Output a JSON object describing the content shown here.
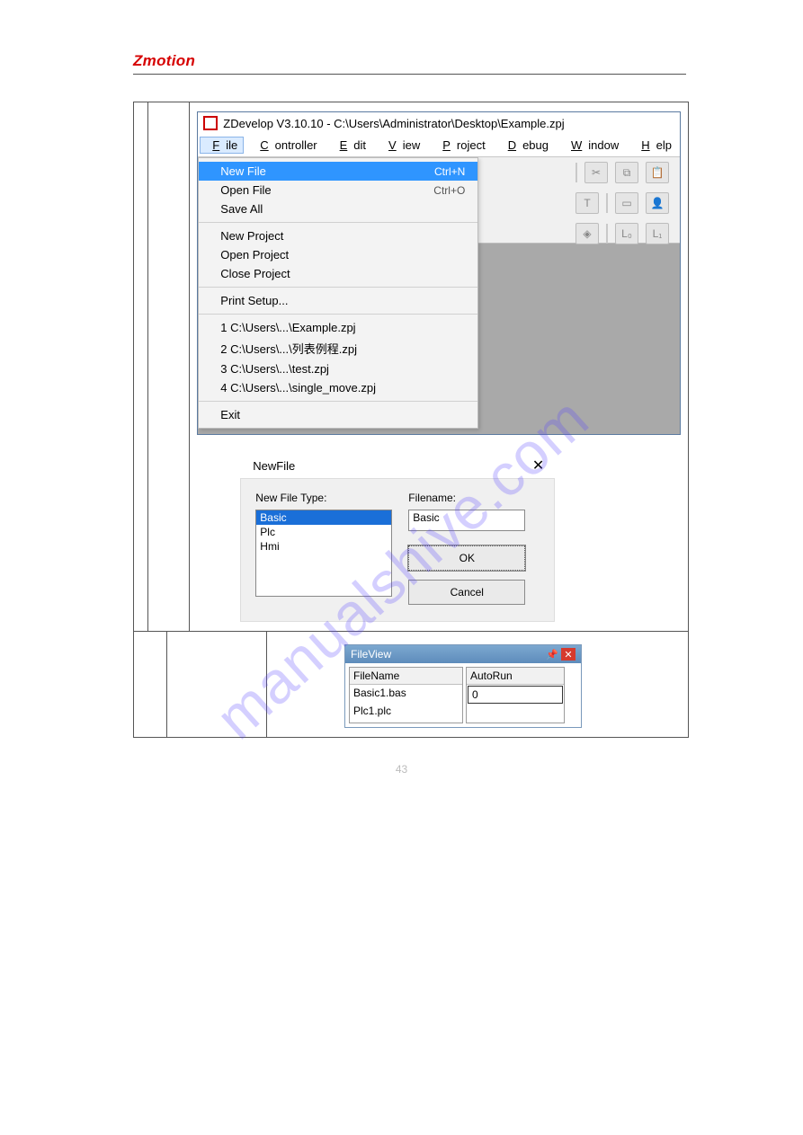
{
  "brand": "Zmotion",
  "watermark": "manualshive.com",
  "page_number": "43",
  "app": {
    "title": "ZDevelop V3.10.10 - C:\\Users\\Administrator\\Desktop\\Example.zpj",
    "menus": [
      "File",
      "Controller",
      "Edit",
      "View",
      "Project",
      "Debug",
      "Window",
      "Help"
    ],
    "dropdown": {
      "groups": [
        [
          {
            "label": "New File",
            "shortcut": "Ctrl+N",
            "selected": true
          },
          {
            "label": "Open File",
            "shortcut": "Ctrl+O"
          },
          {
            "label": "Save All"
          }
        ],
        [
          {
            "label": "New Project"
          },
          {
            "label": "Open Project"
          },
          {
            "label": "Close Project"
          }
        ],
        [
          {
            "label": "Print Setup..."
          }
        ],
        [
          {
            "label": "1 C:\\Users\\...\\Example.zpj"
          },
          {
            "label": "2 C:\\Users\\...\\列表例程.zpj"
          },
          {
            "label": "3 C:\\Users\\...\\test.zpj"
          },
          {
            "label": "4 C:\\Users\\...\\single_move.zpj"
          }
        ],
        [
          {
            "label": "Exit"
          }
        ]
      ]
    },
    "tool_icons": {
      "r1": [
        "cut",
        "copy",
        "paste"
      ],
      "r2": [
        "text",
        "image",
        "person"
      ],
      "r3": [
        "target",
        "L0",
        "L1"
      ]
    }
  },
  "dialog": {
    "title": "NewFile",
    "type_label": "New File Type:",
    "name_label": "Filename:",
    "types": [
      "Basic",
      "Plc",
      "Hmi"
    ],
    "selected_type": "Basic",
    "filename": "Basic",
    "ok": "OK",
    "cancel": "Cancel"
  },
  "fileview": {
    "title": "FileView",
    "col_file": "FileName",
    "col_auto": "AutoRun",
    "rows": [
      {
        "name": "Basic1.bas",
        "auto": "0"
      },
      {
        "name": "Plc1.plc",
        "auto": ""
      }
    ]
  }
}
